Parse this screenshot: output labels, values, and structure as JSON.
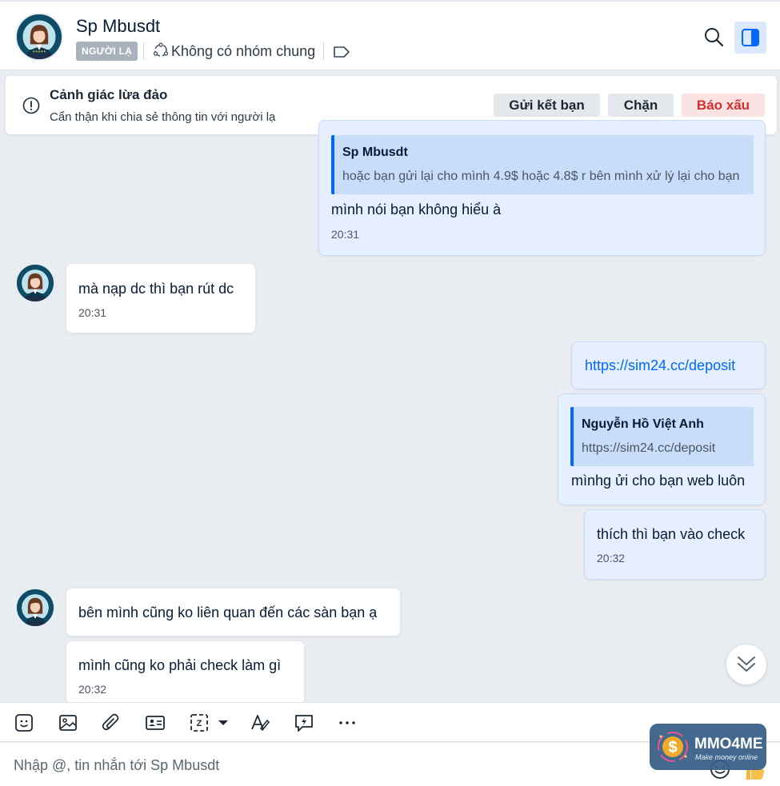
{
  "header": {
    "contact_name": "Sp Mbusdt",
    "stranger_badge": "NGƯỜI LẠ",
    "mutual_groups": "Không có nhóm chung"
  },
  "warning": {
    "title": "Cảnh giác lừa đảo",
    "description": "Cẩn thận khi chia sẻ thông tin với người lạ",
    "add_friend_label": "Gửi kết bạn",
    "block_label": "Chặn",
    "report_label": "Báo xấu"
  },
  "messages": [
    {
      "sender": "me",
      "quote": {
        "author": "Sp Mbusdt",
        "text": "hoặc bạn gửi lại cho mình 4.9$ hoặc 4.8$ r bên mình xử lý lại cho bạn"
      },
      "text": "mình nói bạn không hiểu à",
      "time": "20:31"
    },
    {
      "sender": "them",
      "text": "mà nạp dc thì bạn rút dc",
      "time": "20:31"
    },
    {
      "sender": "me",
      "text": "https://sim24.cc/deposit"
    },
    {
      "sender": "me",
      "quote": {
        "author": "Nguyễn Hồ Việt Anh",
        "text": "https://sim24.cc/deposit"
      },
      "text": "mìnhg ửi cho bạn web luôn"
    },
    {
      "sender": "me",
      "text": "thích thì bạn vào check",
      "time": "20:32"
    },
    {
      "sender": "them",
      "text": "bên mình cũng ko liên quan đến các sàn bạn ạ"
    },
    {
      "sender": "them",
      "text": "mình cũng ko phải check làm gì",
      "time": "20:32"
    }
  ],
  "composer": {
    "placeholder": "Nhập @, tin nhắn tới Sp Mbusdt"
  },
  "watermark": {
    "title": "MMO4ME",
    "subtitle": "Make money online"
  },
  "colors": {
    "accent": "#0068ff",
    "my_bubble": "#e5efff",
    "report": "#d32f2f"
  }
}
